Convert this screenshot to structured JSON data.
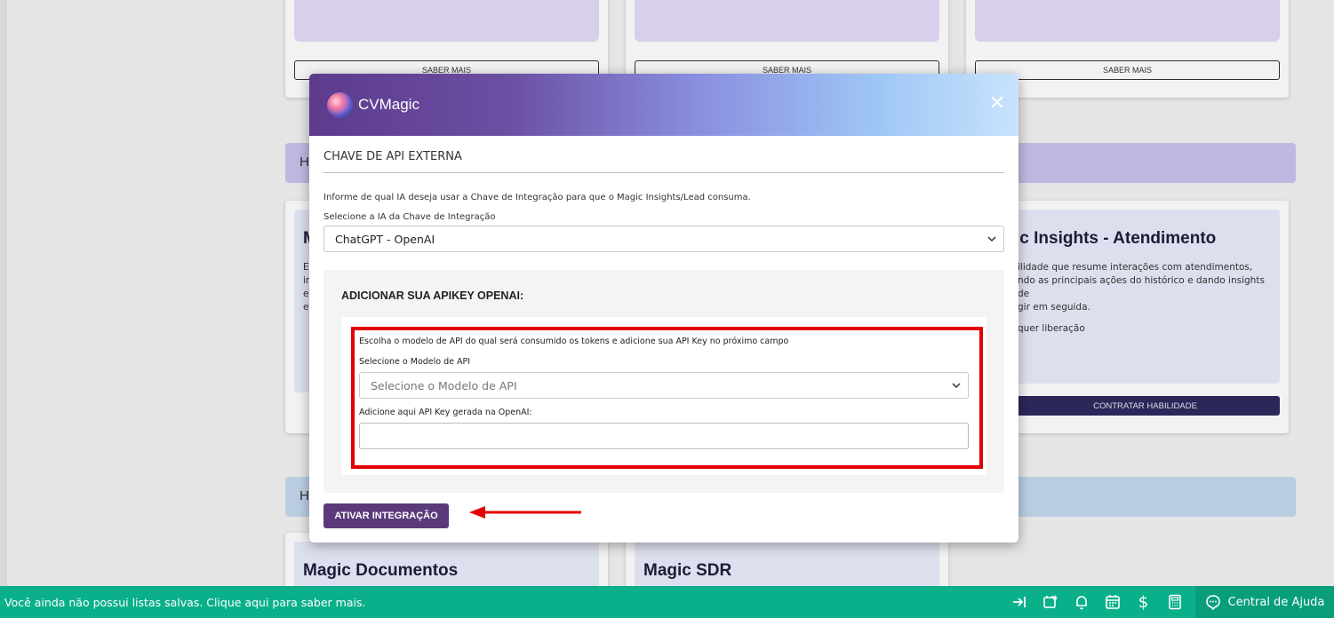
{
  "background": {
    "top_cards": [
      {
        "button_label": "SABER MAIS"
      },
      {
        "button_label": "SABER MAIS"
      },
      {
        "button_label": "SABER MAIS"
      }
    ],
    "section1_label": "H",
    "section2_label": "H",
    "skill_left_title": "M",
    "skill_left_text": [
      "E",
      "in",
      "e",
      "e"
    ],
    "skill_right": {
      "title": "ic Insights - Atendimento",
      "text": "ilidade que resume interações com atendimentos,\nndo as principais ações do histórico e dando insights de\ngir em seguida.",
      "link": "quer liberação",
      "button_label": "CONTRATAR HABILIDADE"
    },
    "bottom_cards": [
      "Magic Documentos",
      "Magic SDR"
    ]
  },
  "modal": {
    "brand": "CVMagic",
    "close_symbol": "✕",
    "section_title": "CHAVE DE API EXTERNA",
    "info_text": "Informe de qual IA deseja usar a Chave de Integração para que o Magic Insights/Lead consuma.",
    "ia_select_label": "Selecione a IA da Chave de Integração",
    "ia_select_value": "ChatGPT - OpenAI",
    "apikey_title": "ADICIONAR SUA APIKEY OPENAI:",
    "model_help_text": "Escolha o modelo de API do qual será consumido os tokens e adicione sua API Key no próximo campo",
    "model_select_label": "Selecione o Modelo de API",
    "model_select_placeholder": "Selecione o Modelo de API",
    "apikey_input_label": "Adicione aqui API Key gerada na OpenAI:",
    "apikey_input_value": "",
    "activate_button": "ATIVAR INTEGRAÇÃO"
  },
  "status_bar": {
    "message": "Você ainda não possui listas salvas. Clique aqui para saber mais.",
    "icons": [
      "exit-icon",
      "calendar-star-icon",
      "bell-icon",
      "calendar-icon",
      "dollar-icon",
      "calculator-icon"
    ],
    "help_label": "Central de Ajuda",
    "color": "#0ab08a"
  },
  "colors": {
    "accent": "#5a3a7a",
    "highlight": "#e40000"
  }
}
